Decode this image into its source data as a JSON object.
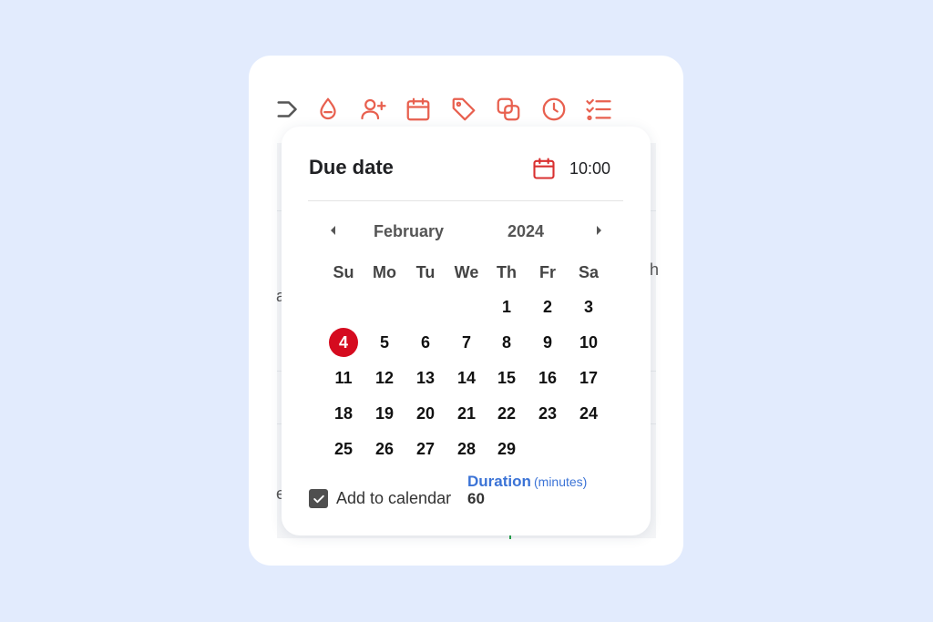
{
  "toolbar": {
    "color": "#e8604f",
    "icons": [
      "collapse-arrow-icon",
      "water-drop-minus-icon",
      "add-user-icon",
      "calendar-icon",
      "tag-icon",
      "link-icon",
      "clock-icon",
      "checklist-icon"
    ]
  },
  "background_fragments": [
    "a",
    "h",
    "e"
  ],
  "popup": {
    "title": "Due date",
    "time": "10:00",
    "month": "February",
    "year": "2024",
    "weekdays": [
      "Su",
      "Mo",
      "Tu",
      "We",
      "Th",
      "Fr",
      "Sa"
    ],
    "weeks": [
      [
        "",
        "",
        "",
        "",
        "1",
        "2",
        "3"
      ],
      [
        "4",
        "5",
        "6",
        "7",
        "8",
        "9",
        "10"
      ],
      [
        "11",
        "12",
        "13",
        "14",
        "15",
        "16",
        "17"
      ],
      [
        "18",
        "19",
        "20",
        "21",
        "22",
        "23",
        "24"
      ],
      [
        "25",
        "26",
        "27",
        "28",
        "29",
        "",
        ""
      ]
    ],
    "selected_day": "4",
    "selected_color": "#d50b1f",
    "add_to_calendar_label": "Add to calendar",
    "add_to_calendar_checked": true,
    "duration_label": "Duration",
    "duration_unit": "(minutes)",
    "duration_value": "60"
  }
}
